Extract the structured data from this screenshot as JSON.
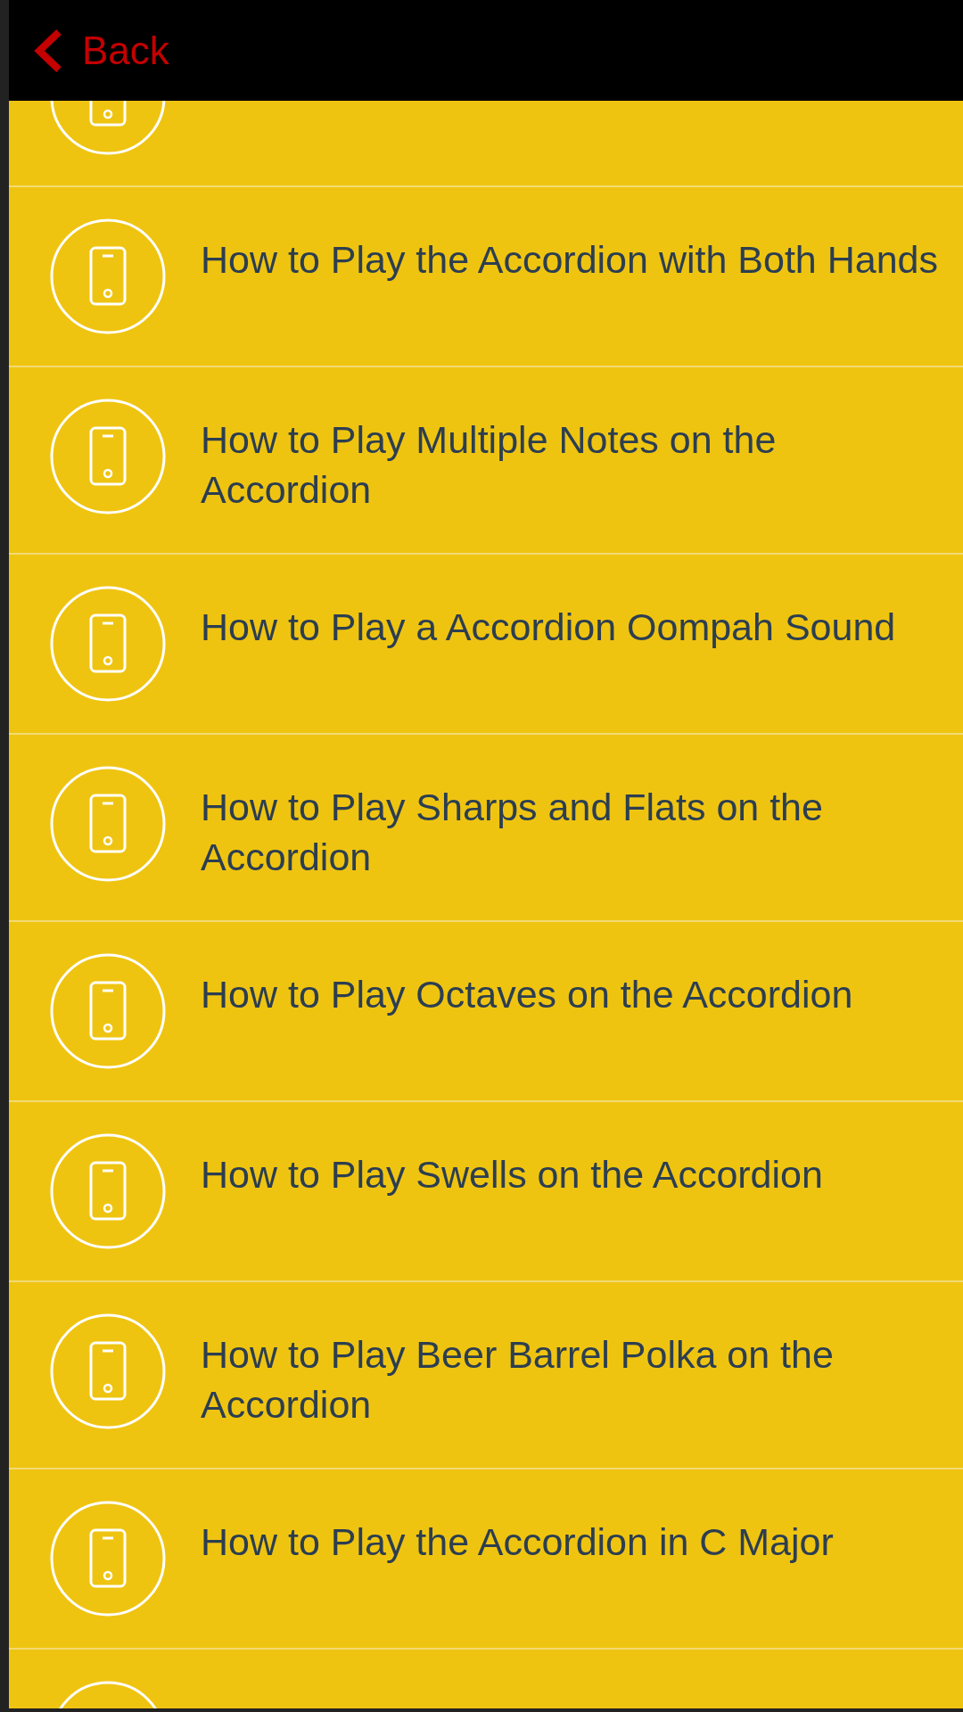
{
  "header": {
    "back_label": "Back"
  },
  "items": [
    {
      "kind": "cut_top"
    },
    {
      "kind": "entry",
      "title": "How to Play the Accordion with Both Hands"
    },
    {
      "kind": "entry",
      "title": "How to Play Multiple Notes on the Accordion"
    },
    {
      "kind": "entry",
      "title": "How to Play a Accordion Oompah Sound"
    },
    {
      "kind": "entry",
      "title": "How to Play Sharps and Flats on the Accordion"
    },
    {
      "kind": "entry",
      "title": "How to Play Octaves on the Accordion"
    },
    {
      "kind": "entry",
      "title": "How to Play Swells on the Accordion"
    },
    {
      "kind": "entry",
      "title": "How to Play Beer Barrel Polka on the Accordion"
    },
    {
      "kind": "entry",
      "title": "How to Play the Accordion in C Major"
    },
    {
      "kind": "cut_bottom"
    }
  ]
}
